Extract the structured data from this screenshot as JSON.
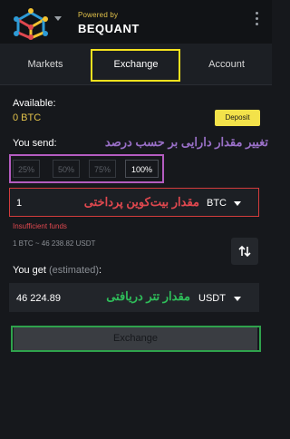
{
  "header": {
    "powered_by": "Powered by",
    "brand": "BEQUANT",
    "logo_icon": "bequant-logo-icon",
    "menu_icon": "vertical-dots-icon"
  },
  "tabs": [
    {
      "label": "Markets"
    },
    {
      "label": "Exchange"
    },
    {
      "label": "Account"
    }
  ],
  "active_tab": "Exchange",
  "available": {
    "label": "Available:",
    "value": "0 BTC",
    "deposit_label": "Deposit"
  },
  "send": {
    "label": "You send:",
    "percent_options": [
      "25%",
      "50%",
      "75%",
      "100%"
    ],
    "selected_percent": "100%",
    "amount": "1",
    "currency": "BTC",
    "error": "Insufficient funds",
    "rate": "1 BTC ~ 46 238.82 USDT"
  },
  "get": {
    "label": "You get",
    "estimated": "(estimated)",
    "suffix": ":",
    "amount": "46 224.89",
    "currency": "USDT"
  },
  "exchange_button": "Exchange",
  "annotations": {
    "percent": "تغییر مقدار دارایی بر حسب درصد",
    "btc_amount": "مقدار بیت‌کوین پرداختی",
    "usdt_amount": "مقدار تتر دریافتی"
  },
  "colors": {
    "accent_yellow": "#f3e24a",
    "error_red": "#e0484f",
    "annotation_purple": "#9a70c8",
    "annotation_green": "#2fbe5a",
    "highlight_yellow": "#f5e21e",
    "highlight_magenta": "#b45cc0",
    "highlight_green": "#2fa24c"
  }
}
